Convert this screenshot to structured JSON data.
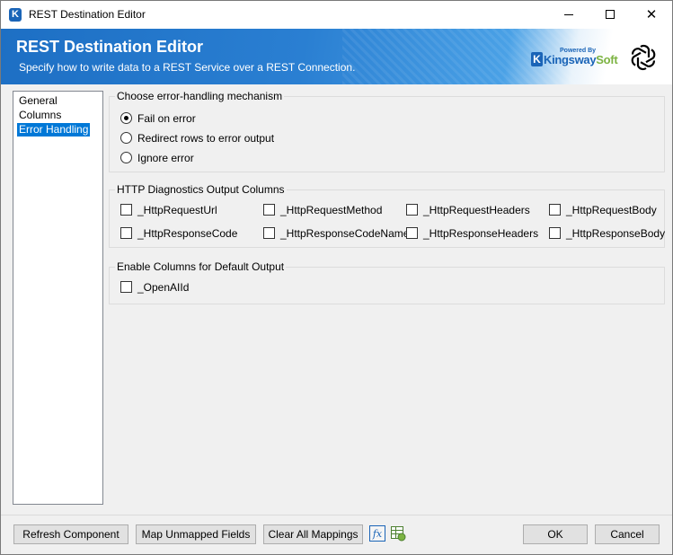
{
  "window": {
    "title": "REST Destination Editor"
  },
  "banner": {
    "title": "REST Destination Editor",
    "subtitle": "Specify how to write data to a REST Service over a REST Connection.",
    "brand": {
      "powered": "Powered By",
      "name_part1": "Kingsway",
      "name_part2": "Soft"
    }
  },
  "nav": {
    "items": [
      {
        "label": "General"
      },
      {
        "label": "Columns"
      },
      {
        "label": "Error Handling",
        "selected": true
      }
    ]
  },
  "error_handling": {
    "legend": "Choose error-handling mechanism",
    "options": [
      {
        "label": "Fail on error",
        "checked": true
      },
      {
        "label": "Redirect rows to error output",
        "checked": false
      },
      {
        "label": "Ignore error",
        "checked": false
      }
    ]
  },
  "http_diagnostics": {
    "legend": "HTTP Diagnostics Output Columns",
    "columns": [
      {
        "label": "_HttpRequestUrl",
        "checked": false
      },
      {
        "label": "_HttpRequestMethod",
        "checked": false
      },
      {
        "label": "_HttpRequestHeaders",
        "checked": false
      },
      {
        "label": "_HttpRequestBody",
        "checked": false
      },
      {
        "label": "_HttpResponseCode",
        "checked": false
      },
      {
        "label": "_HttpResponseCodeName",
        "checked": false
      },
      {
        "label": "_HttpResponseHeaders",
        "checked": false
      },
      {
        "label": "_HttpResponseBody",
        "checked": false
      }
    ]
  },
  "default_output": {
    "legend": "Enable Columns for Default Output",
    "columns": [
      {
        "label": "_OpenAIId",
        "checked": false
      }
    ]
  },
  "footer": {
    "refresh_label": "Refresh Component",
    "map_label": "Map Unmapped Fields",
    "clear_label": "Clear All Mappings",
    "ok_label": "OK",
    "cancel_label": "Cancel"
  },
  "colors": {
    "accent": "#0078d7",
    "banner_blue": "#1d6fc4",
    "brand_green": "#7cb342"
  },
  "icons": [
    "kingswaysoft-app-icon",
    "openai-logo-icon",
    "expression-fx-icon",
    "grid-settings-icon"
  ]
}
